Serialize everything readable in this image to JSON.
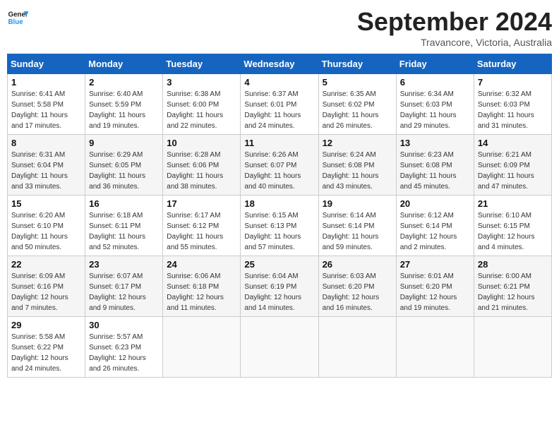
{
  "header": {
    "logo_line1": "General",
    "logo_line2": "Blue",
    "month": "September 2024",
    "location": "Travancore, Victoria, Australia"
  },
  "weekdays": [
    "Sunday",
    "Monday",
    "Tuesday",
    "Wednesday",
    "Thursday",
    "Friday",
    "Saturday"
  ],
  "weeks": [
    [
      {
        "day": "1",
        "sunrise": "6:41 AM",
        "sunset": "5:58 PM",
        "daylight": "11 hours and 17 minutes."
      },
      {
        "day": "2",
        "sunrise": "6:40 AM",
        "sunset": "5:59 PM",
        "daylight": "11 hours and 19 minutes."
      },
      {
        "day": "3",
        "sunrise": "6:38 AM",
        "sunset": "6:00 PM",
        "daylight": "11 hours and 22 minutes."
      },
      {
        "day": "4",
        "sunrise": "6:37 AM",
        "sunset": "6:01 PM",
        "daylight": "11 hours and 24 minutes."
      },
      {
        "day": "5",
        "sunrise": "6:35 AM",
        "sunset": "6:02 PM",
        "daylight": "11 hours and 26 minutes."
      },
      {
        "day": "6",
        "sunrise": "6:34 AM",
        "sunset": "6:03 PM",
        "daylight": "11 hours and 29 minutes."
      },
      {
        "day": "7",
        "sunrise": "6:32 AM",
        "sunset": "6:03 PM",
        "daylight": "11 hours and 31 minutes."
      }
    ],
    [
      {
        "day": "8",
        "sunrise": "6:31 AM",
        "sunset": "6:04 PM",
        "daylight": "11 hours and 33 minutes."
      },
      {
        "day": "9",
        "sunrise": "6:29 AM",
        "sunset": "6:05 PM",
        "daylight": "11 hours and 36 minutes."
      },
      {
        "day": "10",
        "sunrise": "6:28 AM",
        "sunset": "6:06 PM",
        "daylight": "11 hours and 38 minutes."
      },
      {
        "day": "11",
        "sunrise": "6:26 AM",
        "sunset": "6:07 PM",
        "daylight": "11 hours and 40 minutes."
      },
      {
        "day": "12",
        "sunrise": "6:24 AM",
        "sunset": "6:08 PM",
        "daylight": "11 hours and 43 minutes."
      },
      {
        "day": "13",
        "sunrise": "6:23 AM",
        "sunset": "6:08 PM",
        "daylight": "11 hours and 45 minutes."
      },
      {
        "day": "14",
        "sunrise": "6:21 AM",
        "sunset": "6:09 PM",
        "daylight": "11 hours and 47 minutes."
      }
    ],
    [
      {
        "day": "15",
        "sunrise": "6:20 AM",
        "sunset": "6:10 PM",
        "daylight": "11 hours and 50 minutes."
      },
      {
        "day": "16",
        "sunrise": "6:18 AM",
        "sunset": "6:11 PM",
        "daylight": "11 hours and 52 minutes."
      },
      {
        "day": "17",
        "sunrise": "6:17 AM",
        "sunset": "6:12 PM",
        "daylight": "11 hours and 55 minutes."
      },
      {
        "day": "18",
        "sunrise": "6:15 AM",
        "sunset": "6:13 PM",
        "daylight": "11 hours and 57 minutes."
      },
      {
        "day": "19",
        "sunrise": "6:14 AM",
        "sunset": "6:14 PM",
        "daylight": "11 hours and 59 minutes."
      },
      {
        "day": "20",
        "sunrise": "6:12 AM",
        "sunset": "6:14 PM",
        "daylight": "12 hours and 2 minutes."
      },
      {
        "day": "21",
        "sunrise": "6:10 AM",
        "sunset": "6:15 PM",
        "daylight": "12 hours and 4 minutes."
      }
    ],
    [
      {
        "day": "22",
        "sunrise": "6:09 AM",
        "sunset": "6:16 PM",
        "daylight": "12 hours and 7 minutes."
      },
      {
        "day": "23",
        "sunrise": "6:07 AM",
        "sunset": "6:17 PM",
        "daylight": "12 hours and 9 minutes."
      },
      {
        "day": "24",
        "sunrise": "6:06 AM",
        "sunset": "6:18 PM",
        "daylight": "12 hours and 11 minutes."
      },
      {
        "day": "25",
        "sunrise": "6:04 AM",
        "sunset": "6:19 PM",
        "daylight": "12 hours and 14 minutes."
      },
      {
        "day": "26",
        "sunrise": "6:03 AM",
        "sunset": "6:20 PM",
        "daylight": "12 hours and 16 minutes."
      },
      {
        "day": "27",
        "sunrise": "6:01 AM",
        "sunset": "6:20 PM",
        "daylight": "12 hours and 19 minutes."
      },
      {
        "day": "28",
        "sunrise": "6:00 AM",
        "sunset": "6:21 PM",
        "daylight": "12 hours and 21 minutes."
      }
    ],
    [
      {
        "day": "29",
        "sunrise": "5:58 AM",
        "sunset": "6:22 PM",
        "daylight": "12 hours and 24 minutes."
      },
      {
        "day": "30",
        "sunrise": "5:57 AM",
        "sunset": "6:23 PM",
        "daylight": "12 hours and 26 minutes."
      },
      null,
      null,
      null,
      null,
      null
    ]
  ],
  "labels": {
    "sunrise": "Sunrise:",
    "sunset": "Sunset:",
    "daylight": "Daylight:"
  }
}
